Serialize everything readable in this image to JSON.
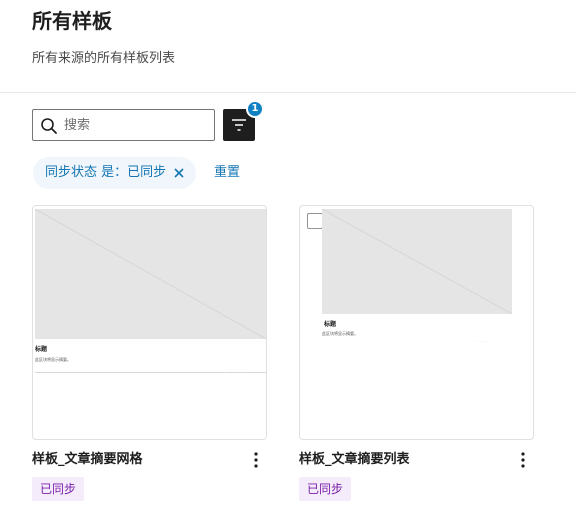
{
  "header": {
    "title": "所有样板",
    "subtitle": "所有来源的所有样板列表"
  },
  "toolbar": {
    "search_placeholder": "搜索",
    "search_value": "",
    "filter_count": "1"
  },
  "filters": {
    "active_chip": "同步状态 是：已同步",
    "reset_label": "重置"
  },
  "patterns": [
    {
      "title": "样板_文章摘要网格",
      "status": "已同步",
      "preview_heading": "标题",
      "preview_excerpt": "此区块将显示摘要。"
    },
    {
      "title": "样板_文章摘要列表",
      "status": "已同步",
      "preview_heading": "标题",
      "preview_excerpt": "此区块将显示摘要。"
    }
  ],
  "colors": {
    "accent": "#1576b4",
    "badge_blue": "#1281c4",
    "synced_bg": "#f5ecfb",
    "synced_text": "#7a1fa8",
    "dark": "#1e1e1e"
  },
  "icons": [
    "search-icon",
    "filter-icon",
    "close-icon",
    "more-vertical-icon",
    "checkbox-icon"
  ]
}
